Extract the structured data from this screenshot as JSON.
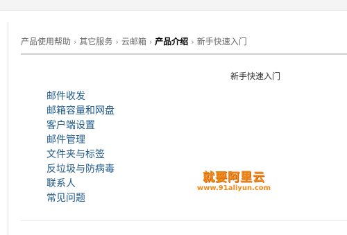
{
  "breadcrumb": {
    "items": [
      {
        "label": "产品使用帮助"
      },
      {
        "label": "其它服务"
      },
      {
        "label": "云邮箱"
      },
      {
        "label": "产品介绍"
      },
      {
        "label": "新手快速入门"
      }
    ],
    "separator": "›"
  },
  "content": {
    "section_title": "新手快速入门",
    "menu_items": [
      {
        "label": "邮件收发"
      },
      {
        "label": "邮箱容量和网盘"
      },
      {
        "label": "客户端设置"
      },
      {
        "label": "邮件管理"
      },
      {
        "label": "文件夹与标签"
      },
      {
        "label": "反垃圾与防病毒"
      },
      {
        "label": "联系人"
      },
      {
        "label": "常见问题"
      }
    ]
  },
  "watermark": {
    "title": "就要阿里云",
    "url": "www.91aliyun.com"
  },
  "colors": {
    "link": "#1f5a8c",
    "watermark": "#f28a1a",
    "breadcrumb_text": "#666666"
  }
}
